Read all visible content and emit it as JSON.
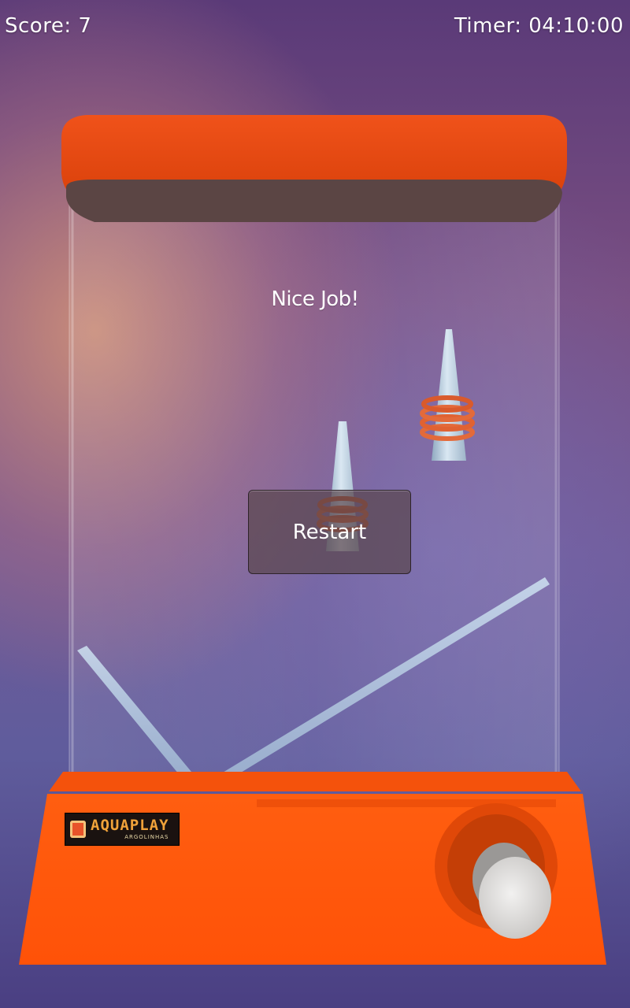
{
  "hud": {
    "score_label": "Score: 7",
    "timer_label": "Timer: 04:10:00"
  },
  "overlay": {
    "message": "Nice Job!",
    "restart_label": "Restart"
  },
  "game_state": {
    "score": 7,
    "timer": "04:10:00",
    "pegs": [
      {
        "name": "left-peg",
        "rings_on_peg": 3
      },
      {
        "name": "right-peg",
        "rings_on_peg": 4
      }
    ]
  },
  "toy": {
    "logo_title": "AQUAPLAY",
    "logo_sub": "ARGOLINHAS",
    "colors": {
      "body": "#ff5a0a",
      "cap": "#e3460e",
      "ring": "#e36a3a",
      "peg": "#b9cfe0",
      "button": "#d8d6d4"
    }
  }
}
